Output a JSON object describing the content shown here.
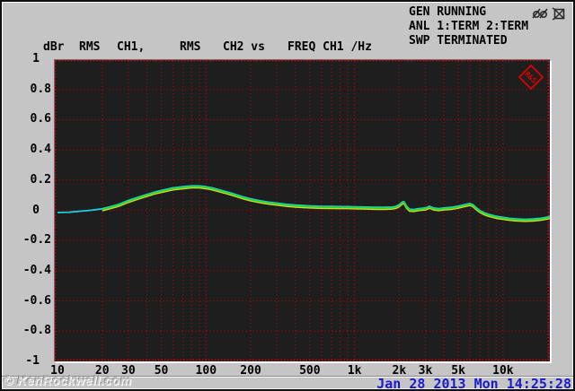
{
  "colors": {
    "background": "#c5c5c5",
    "plot_background": "#1e1e1e",
    "grid_red": "#c60000",
    "border_red": "#e60000",
    "trace_ch1_cyan": "#15d4e6",
    "trace_ch2_green": "#2fd626",
    "trace_fringe_yellow": "#d8da25",
    "datetime_blue": "#1a1acd",
    "logo_red": "#e00000"
  },
  "status_panel": {
    "lines": [
      "GEN RUNNING",
      "ANL 1:TERM 2:TERM",
      "SWP TERMINATED"
    ],
    "icons": [
      "keyboard-disabled-icon",
      "monitor-disabled-icon"
    ]
  },
  "header": {
    "unit": "dBr",
    "trace1_detector": "RMS",
    "trace1_channel": "CH1,",
    "trace2_detector": "RMS",
    "trace2_channel": "CH2 vs",
    "x_axis_label": "FREQ CH1 /Hz"
  },
  "logo": {
    "label": "R&S"
  },
  "footer": {
    "watermark": "© KenRockwell.com",
    "datetime": "Jan 28 2013 Mon 14:25:28"
  },
  "chart_data": {
    "type": "line",
    "title": "RMS CH1, RMS CH2 vs FREQ CH1 /Hz",
    "xlabel": "FREQ CH1 /Hz",
    "ylabel": "dBr",
    "x_scale": "log",
    "x_range": [
      10,
      21000
    ],
    "y_range": [
      -1,
      1
    ],
    "grid": {
      "style": "red dotted",
      "v_freqs": [
        20,
        30,
        40,
        50,
        60,
        70,
        80,
        90,
        100,
        200,
        300,
        400,
        500,
        600,
        700,
        800,
        900,
        1000,
        2000,
        3000,
        4000,
        5000,
        6000,
        7000,
        8000,
        9000,
        10000,
        20000
      ],
      "h_values": [
        0.8,
        0.6,
        0.4,
        0.2,
        0,
        -0.2,
        -0.4,
        -0.6,
        -0.8
      ]
    },
    "x_ticks": [
      {
        "f": 10,
        "label": "10"
      },
      {
        "f": 20,
        "label": "20"
      },
      {
        "f": 30,
        "label": "30"
      },
      {
        "f": 50,
        "label": "50"
      },
      {
        "f": 100,
        "label": "100"
      },
      {
        "f": 200,
        "label": "200"
      },
      {
        "f": 500,
        "label": "500"
      },
      {
        "f": 1000,
        "label": "1k"
      },
      {
        "f": 2000,
        "label": "2k"
      },
      {
        "f": 3000,
        "label": "3k"
      },
      {
        "f": 5000,
        "label": "5k"
      },
      {
        "f": 10000,
        "label": "10k"
      }
    ],
    "y_ticks": [
      {
        "v": 1,
        "label": "1"
      },
      {
        "v": 0.8,
        "label": "0.8"
      },
      {
        "v": 0.6,
        "label": "0.6"
      },
      {
        "v": 0.4,
        "label": "0.4"
      },
      {
        "v": 0.2,
        "label": "0.2"
      },
      {
        "v": 0,
        "label": "0"
      },
      {
        "v": -0.2,
        "label": "-0.2"
      },
      {
        "v": -0.4,
        "label": "-0.4"
      },
      {
        "v": -0.6,
        "label": "-0.6"
      },
      {
        "v": -0.8,
        "label": "-0.8"
      },
      {
        "v": -1,
        "label": "-1"
      }
    ],
    "series": [
      {
        "name": "RMS CH1",
        "color": "#15d4e6",
        "points": [
          [
            10,
            -0.02
          ],
          [
            12,
            -0.018
          ],
          [
            14,
            -0.012
          ],
          [
            17,
            -0.005
          ],
          [
            20,
            0.005
          ],
          [
            23,
            0.02
          ],
          [
            26,
            0.035
          ],
          [
            30,
            0.06
          ],
          [
            35,
            0.082
          ],
          [
            40,
            0.1
          ],
          [
            45,
            0.115
          ],
          [
            50,
            0.126
          ],
          [
            55,
            0.135
          ],
          [
            60,
            0.143
          ],
          [
            70,
            0.151
          ],
          [
            80,
            0.156
          ],
          [
            90,
            0.156
          ],
          [
            100,
            0.151
          ],
          [
            110,
            0.143
          ],
          [
            120,
            0.133
          ],
          [
            140,
            0.115
          ],
          [
            160,
            0.098
          ],
          [
            180,
            0.082
          ],
          [
            200,
            0.07
          ],
          [
            230,
            0.058
          ],
          [
            260,
            0.049
          ],
          [
            300,
            0.042
          ],
          [
            350,
            0.034
          ],
          [
            400,
            0.029
          ],
          [
            450,
            0.026
          ],
          [
            500,
            0.024
          ],
          [
            600,
            0.021
          ],
          [
            700,
            0.02
          ],
          [
            800,
            0.019
          ],
          [
            900,
            0.019
          ],
          [
            1000,
            0.018
          ],
          [
            1200,
            0.016
          ],
          [
            1400,
            0.014
          ],
          [
            1600,
            0.014
          ],
          [
            1800,
            0.016
          ],
          [
            1900,
            0.02
          ],
          [
            2000,
            0.032
          ],
          [
            2100,
            0.05
          ],
          [
            2150,
            0.052
          ],
          [
            2250,
            0.02
          ],
          [
            2350,
            0.002
          ],
          [
            2500,
            0
          ],
          [
            2700,
            0.006
          ],
          [
            3000,
            0.01
          ],
          [
            3200,
            0.022
          ],
          [
            3400,
            0.01
          ],
          [
            3700,
            0.006
          ],
          [
            4000,
            0.01
          ],
          [
            4500,
            0.014
          ],
          [
            5000,
            0.022
          ],
          [
            5500,
            0.032
          ],
          [
            6000,
            0.04
          ],
          [
            6300,
            0.03
          ],
          [
            6600,
            0.012
          ],
          [
            7000,
            -0.008
          ],
          [
            7500,
            -0.022
          ],
          [
            8000,
            -0.032
          ],
          [
            9000,
            -0.045
          ],
          [
            10000,
            -0.052
          ],
          [
            11000,
            -0.058
          ],
          [
            12000,
            -0.062
          ],
          [
            14000,
            -0.065
          ],
          [
            16000,
            -0.063
          ],
          [
            18000,
            -0.058
          ],
          [
            20000,
            -0.05
          ],
          [
            20700,
            -0.045
          ]
        ]
      },
      {
        "name": "RMS CH2",
        "color": "#2fd626",
        "points": [
          [
            20,
            0.005
          ],
          [
            23,
            0.02
          ],
          [
            26,
            0.035
          ],
          [
            30,
            0.06
          ],
          [
            35,
            0.082
          ],
          [
            40,
            0.1
          ],
          [
            45,
            0.115
          ],
          [
            50,
            0.126
          ],
          [
            55,
            0.135
          ],
          [
            60,
            0.143
          ],
          [
            70,
            0.151
          ],
          [
            80,
            0.156
          ],
          [
            90,
            0.156
          ],
          [
            100,
            0.151
          ],
          [
            110,
            0.143
          ],
          [
            120,
            0.133
          ],
          [
            140,
            0.115
          ],
          [
            160,
            0.098
          ],
          [
            180,
            0.082
          ],
          [
            200,
            0.07
          ],
          [
            230,
            0.058
          ],
          [
            260,
            0.049
          ],
          [
            300,
            0.042
          ],
          [
            350,
            0.034
          ],
          [
            400,
            0.029
          ],
          [
            450,
            0.026
          ],
          [
            500,
            0.024
          ],
          [
            600,
            0.021
          ],
          [
            700,
            0.02
          ],
          [
            800,
            0.019
          ],
          [
            900,
            0.019
          ],
          [
            1000,
            0.018
          ],
          [
            1200,
            0.016
          ],
          [
            1400,
            0.014
          ],
          [
            1600,
            0.014
          ],
          [
            1800,
            0.016
          ],
          [
            1900,
            0.02
          ],
          [
            2000,
            0.032
          ],
          [
            2100,
            0.05
          ],
          [
            2150,
            0.052
          ],
          [
            2250,
            0.02
          ],
          [
            2350,
            0.002
          ],
          [
            2500,
            0
          ],
          [
            2700,
            0.006
          ],
          [
            3000,
            0.01
          ],
          [
            3200,
            0.022
          ],
          [
            3400,
            0.01
          ],
          [
            3700,
            0.006
          ],
          [
            4000,
            0.01
          ],
          [
            4500,
            0.014
          ],
          [
            5000,
            0.022
          ],
          [
            5500,
            0.032
          ],
          [
            6000,
            0.04
          ],
          [
            6300,
            0.03
          ],
          [
            6600,
            0.012
          ],
          [
            7000,
            -0.008
          ],
          [
            7500,
            -0.022
          ],
          [
            8000,
            -0.032
          ],
          [
            9000,
            -0.045
          ],
          [
            10000,
            -0.052
          ],
          [
            11000,
            -0.058
          ],
          [
            12000,
            -0.062
          ],
          [
            14000,
            -0.065
          ],
          [
            16000,
            -0.063
          ],
          [
            18000,
            -0.058
          ],
          [
            20000,
            -0.05
          ],
          [
            20700,
            -0.045
          ]
        ]
      }
    ],
    "legend": "none"
  }
}
